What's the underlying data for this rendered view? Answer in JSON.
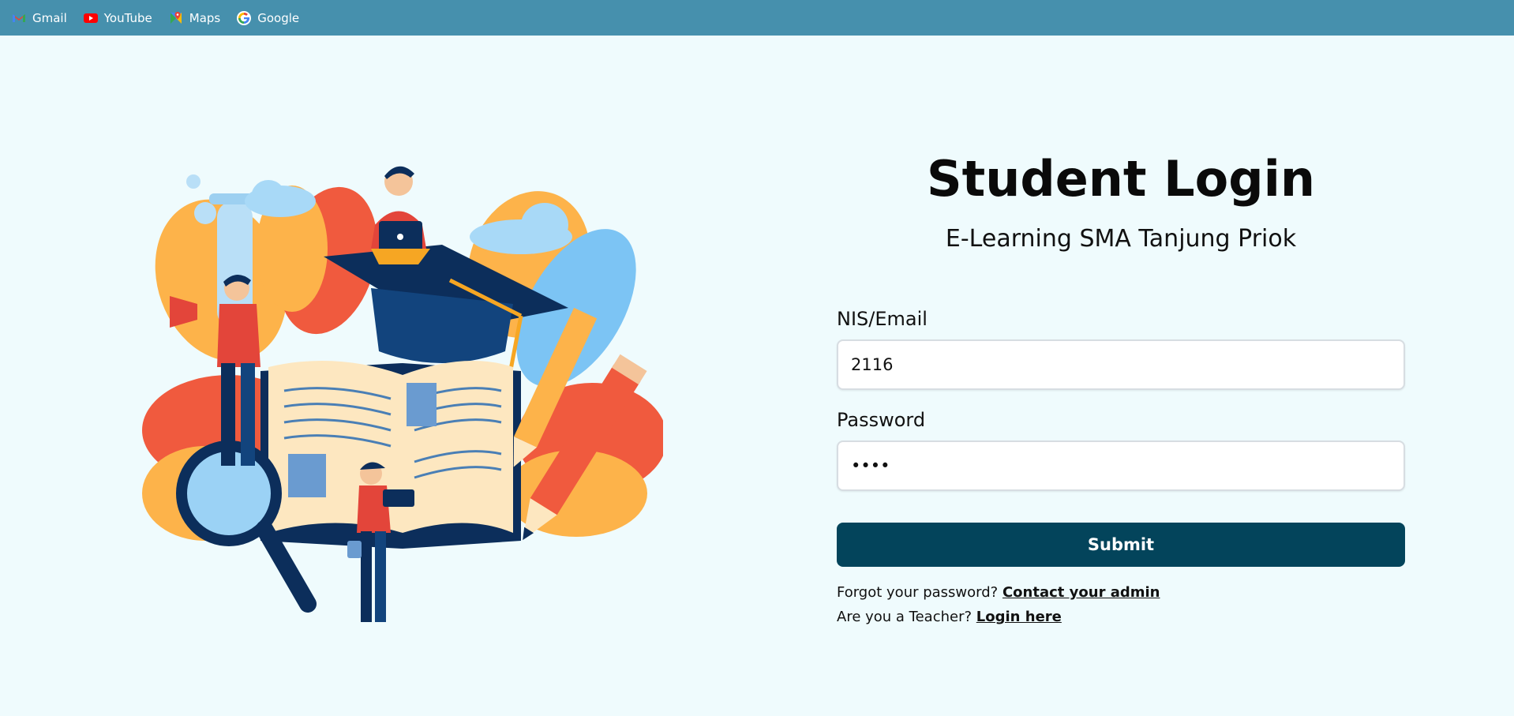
{
  "bookmarks": [
    {
      "label": "Gmail",
      "icon": "gmail-icon"
    },
    {
      "label": "YouTube",
      "icon": "youtube-icon"
    },
    {
      "label": "Maps",
      "icon": "maps-icon"
    },
    {
      "label": "Google",
      "icon": "google-icon"
    }
  ],
  "login": {
    "title": "Student Login",
    "subtitle": "E-Learning SMA Tanjung Priok",
    "nis_label": "NIS/Email",
    "nis_value": "2116",
    "password_label": "Password",
    "password_value": "••••",
    "submit_label": "Submit",
    "forgot_text": "Forgot your password?",
    "forgot_link": "Contact your admin",
    "teacher_text": "Are you a Teacher?",
    "teacher_link": "Login here"
  },
  "colors": {
    "bookmark_bar": "#4690ad",
    "page_bg": "#effbfd",
    "submit_bg": "#03445b"
  }
}
